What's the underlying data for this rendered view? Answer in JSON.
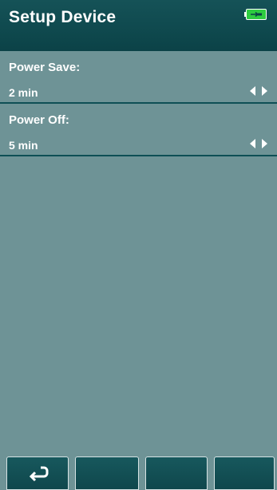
{
  "header": {
    "title": "Setup Device",
    "battery_icon": "battery-charging-icon"
  },
  "settings": [
    {
      "label": "Power Save:",
      "value": "2 min",
      "control_icon": "left-right-arrows-icon"
    },
    {
      "label": "Power Off:",
      "value": "5 min",
      "control_icon": "left-right-arrows-icon"
    }
  ],
  "footer": {
    "buttons": [
      {
        "icon": "return-icon"
      },
      {
        "icon": ""
      },
      {
        "icon": ""
      },
      {
        "icon": ""
      }
    ]
  },
  "colors": {
    "header_bg": "#0f494e",
    "body_bg": "#6e9396",
    "divider": "#0e4f55",
    "battery_fill": "#2ecc40",
    "text": "#ffffff"
  }
}
